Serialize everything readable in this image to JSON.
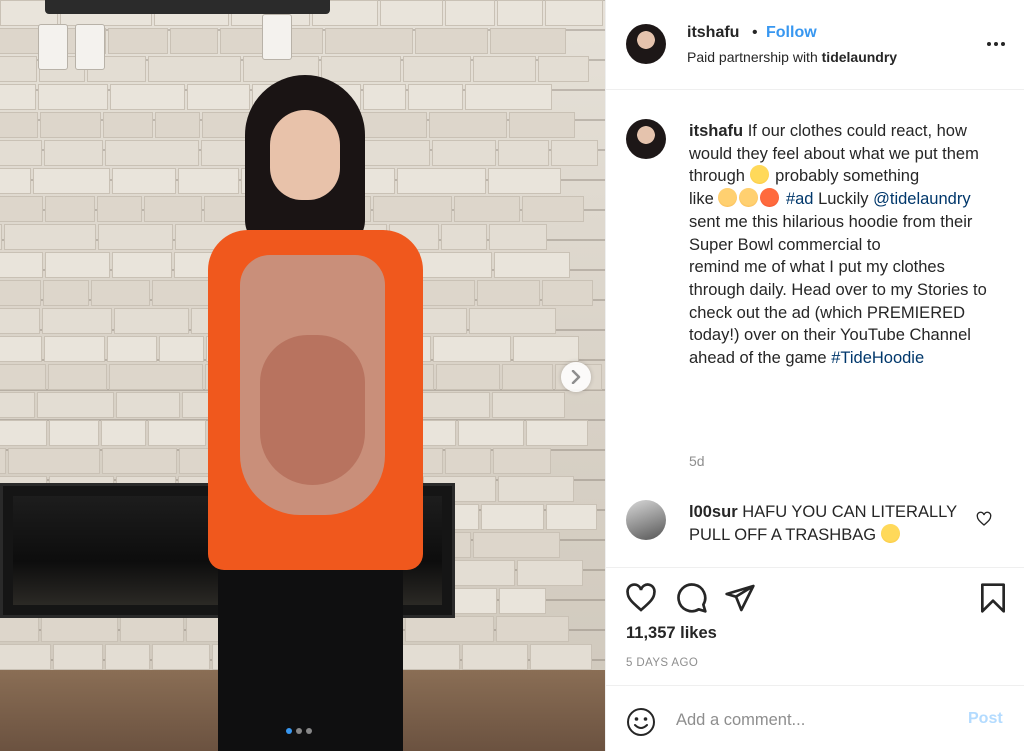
{
  "header": {
    "username": "itshafu",
    "separator": "•",
    "follow_label": "Follow",
    "partnership_prefix": "Paid partnership with",
    "partner": "tidelaundry"
  },
  "caption": {
    "username": "itshafu",
    "text_1": "If our clothes could react, how would they feel about what we put them through",
    "text_2": "probably something",
    "text_3": "like",
    "hashtag_ad": "#ad",
    "text_4": "Luckily",
    "mention": "@tidelaundry",
    "text_5": "sent me this hilarious hoodie from their Super Bowl commercial to",
    "text_6": "remind me of what I put my clothes through daily. Head over to my Stories to check out the ad (which PREMIERED today!) over on their YouTube Channel ahead of the game",
    "hashtag_hoodie": "#TideHoodie",
    "age": "5d"
  },
  "comments": [
    {
      "username": "l00sur",
      "text": "HAFU YOU CAN LITERALLY PULL OFF A TRASHBAG"
    }
  ],
  "actions": {
    "likes": "11,357 likes",
    "date": "5 DAYS AGO"
  },
  "add_comment": {
    "placeholder": "Add a comment...",
    "post_label": "Post"
  },
  "icons": {
    "more": "more-options-icon",
    "like": "heart-icon",
    "comment": "comment-icon",
    "share": "share-icon",
    "save": "bookmark-icon",
    "emoji": "smiley-icon",
    "next": "chevron-right-icon"
  },
  "colors": {
    "link_blue": "#3897f0",
    "hashtag": "#00376b",
    "muted": "#8e8e8e",
    "post_disabled": "#b3dbff"
  },
  "carousel": {
    "count": 3,
    "active": 1
  }
}
